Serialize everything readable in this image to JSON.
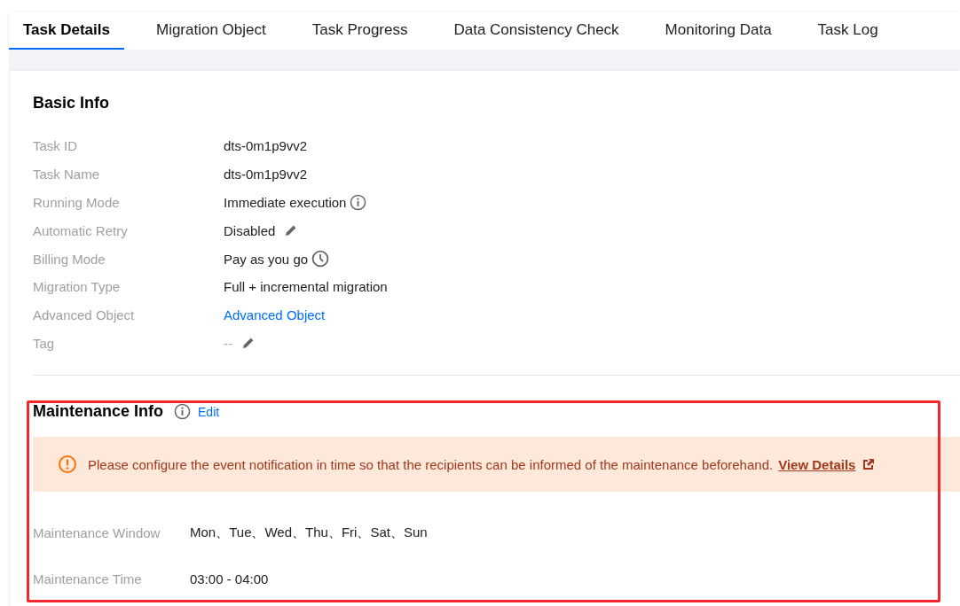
{
  "tabs": [
    {
      "label": "Task Details",
      "selected": true
    },
    {
      "label": "Migration Object",
      "selected": false
    },
    {
      "label": "Task Progress",
      "selected": false
    },
    {
      "label": "Data Consistency Check",
      "selected": false
    },
    {
      "label": "Monitoring Data",
      "selected": false
    },
    {
      "label": "Task Log",
      "selected": false
    }
  ],
  "basic_info": {
    "title": "Basic Info",
    "rows": [
      {
        "label": "Task ID",
        "value": "dts-0m1p9vv2",
        "kind": "plain"
      },
      {
        "label": "Task Name",
        "value": "dts-0m1p9vv2",
        "kind": "plain"
      },
      {
        "label": "Running Mode",
        "value": "Immediate execution",
        "kind": "info"
      },
      {
        "label": "Automatic Retry",
        "value": "Disabled",
        "kind": "edit"
      },
      {
        "label": "Billing Mode",
        "value": "Pay as you go",
        "kind": "clock"
      },
      {
        "label": "Migration Type",
        "value": "Full + incremental migration",
        "kind": "plain"
      },
      {
        "label": "Advanced Object",
        "value": "Advanced Object",
        "kind": "link"
      },
      {
        "label": "Tag",
        "value": "--",
        "kind": "empty-edit"
      }
    ]
  },
  "maintenance_info": {
    "title": "Maintenance Info",
    "edit_link": "Edit",
    "notice": {
      "text": "Please configure the event notification in time so that the recipients can be informed of the maintenance beforehand.",
      "link": "View Details"
    },
    "rows": [
      {
        "label": "Maintenance Window",
        "value": "Mon、Tue、Wed、Thu、Fri、Sat、Sun"
      },
      {
        "label": "Maintenance Time",
        "value": "03:00 - 04:00"
      }
    ]
  }
}
